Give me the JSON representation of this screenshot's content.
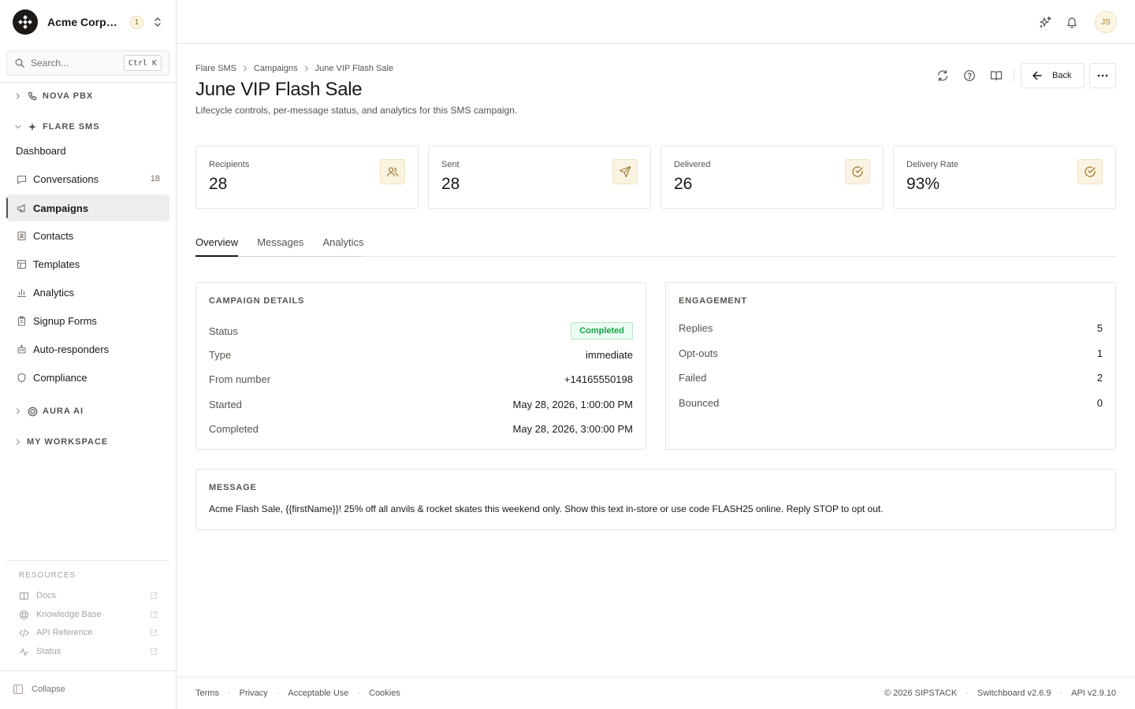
{
  "org": {
    "name": "Acme Corporation",
    "notifications": "1"
  },
  "search": {
    "placeholder": "Search...",
    "shortcut": "Ctrl K"
  },
  "sidebar": {
    "sections": [
      {
        "label": "NOVA PBX",
        "expanded": false,
        "icon": "phone-icon"
      },
      {
        "label": "FLARE SMS",
        "expanded": true,
        "icon": "sparkle-icon"
      },
      {
        "label": "AURA AI",
        "expanded": false,
        "icon": "target-icon"
      },
      {
        "label": "MY WORKSPACE",
        "expanded": false
      }
    ],
    "items": [
      {
        "label": "Dashboard"
      },
      {
        "label": "Conversations",
        "icon": "chat-icon",
        "count": "18"
      },
      {
        "label": "Campaigns",
        "icon": "megaphone-icon",
        "active": true
      },
      {
        "label": "Contacts",
        "icon": "contact-card-icon"
      },
      {
        "label": "Templates",
        "icon": "template-icon"
      },
      {
        "label": "Analytics",
        "icon": "bar-chart-icon"
      },
      {
        "label": "Signup Forms",
        "icon": "clipboard-icon"
      },
      {
        "label": "Auto-responders",
        "icon": "robot-icon"
      },
      {
        "label": "Compliance",
        "icon": "shield-icon"
      }
    ],
    "resources": {
      "title": "RESOURCES",
      "items": [
        {
          "label": "Docs",
          "icon": "book-icon"
        },
        {
          "label": "Knowledge Base",
          "icon": "lifebuoy-icon"
        },
        {
          "label": "API Reference",
          "icon": "code-icon"
        },
        {
          "label": "Status",
          "icon": "activity-icon"
        }
      ]
    },
    "collapse_label": "Collapse"
  },
  "topbar": {
    "avatar_initials": "JS"
  },
  "breadcrumb": [
    "Flare SMS",
    "Campaigns",
    "June VIP Flash Sale"
  ],
  "page": {
    "title": "June VIP Flash Sale",
    "subtitle": "Lifecycle controls, per-message status, and analytics for this SMS campaign.",
    "back_label": "Back"
  },
  "stats": [
    {
      "label": "Recipients",
      "value": "28",
      "icon": "users-icon"
    },
    {
      "label": "Sent",
      "value": "28",
      "icon": "send-icon"
    },
    {
      "label": "Delivered",
      "value": "26",
      "icon": "check-circle-icon"
    },
    {
      "label": "Delivery Rate",
      "value": "93%",
      "icon": "check-circle-icon"
    }
  ],
  "tabs": [
    {
      "label": "Overview",
      "active": true
    },
    {
      "label": "Messages",
      "active": false
    },
    {
      "label": "Analytics",
      "active": false
    }
  ],
  "details": {
    "title": "CAMPAIGN DETAILS",
    "status_label": "Status",
    "status_value": "Completed",
    "rows": [
      {
        "k": "Type",
        "v": "immediate"
      },
      {
        "k": "From number",
        "v": "+14165550198"
      },
      {
        "k": "Started",
        "v": "May 28, 2026, 1:00:00 PM"
      },
      {
        "k": "Completed",
        "v": "May 28, 2026, 3:00:00 PM"
      }
    ]
  },
  "engagement": {
    "title": "ENGAGEMENT",
    "rows": [
      {
        "k": "Replies",
        "v": "5"
      },
      {
        "k": "Opt-outs",
        "v": "1"
      },
      {
        "k": "Failed",
        "v": "2"
      },
      {
        "k": "Bounced",
        "v": "0"
      }
    ]
  },
  "message": {
    "title": "MESSAGE",
    "text": "Acme Flash Sale, {{firstName}}! 25% off all anvils & rocket skates this weekend only. Show this text in-store or use code FLASH25 online. Reply STOP to opt out."
  },
  "footer": {
    "links": [
      "Terms",
      "Privacy",
      "Acceptable Use",
      "Cookies"
    ],
    "copyright": "© 2026 SIPSTACK",
    "app_version": "Switchboard v2.6.9",
    "api_version": "API v2.9.10"
  },
  "colors": {
    "accent": "#a07d35",
    "success": "#16a34a",
    "text": "#1c1917"
  }
}
